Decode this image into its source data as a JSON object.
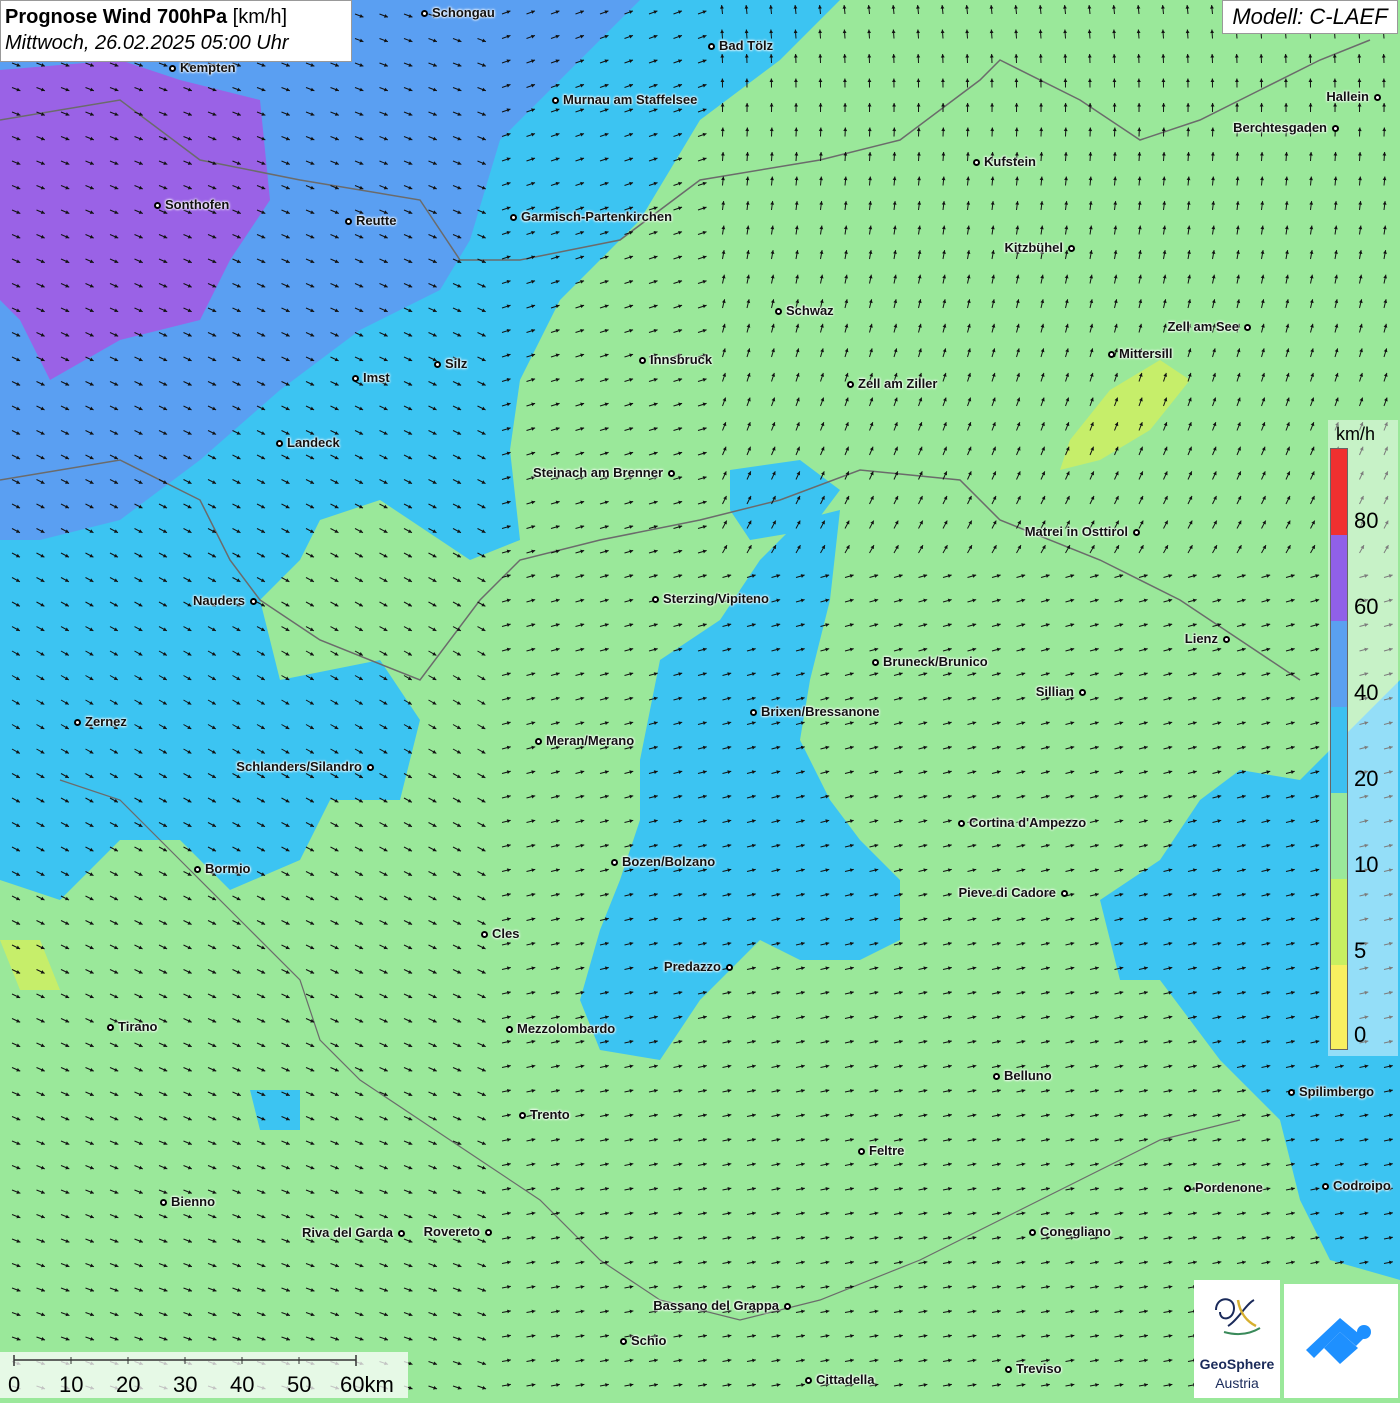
{
  "title": {
    "main": "Prognose Wind 700hPa",
    "unit": "[km/h]",
    "datetime": "Mittwoch, 26.02.2025 05:00 Uhr"
  },
  "model": "Modell: C-LAEF",
  "legend": {
    "unit": "km/h",
    "ticks": [
      "80",
      "60",
      "40",
      "20",
      "10",
      "5",
      "0"
    ],
    "colors": {
      "c80": "#f03030",
      "c60": "#9060e8",
      "c40": "#5aa0f0",
      "c20": "#3cc0f0",
      "c10": "#9ae89a",
      "c5": "#c8f060",
      "c0": "#f8f060"
    }
  },
  "scale": {
    "labels": [
      "0",
      "10",
      "20",
      "30",
      "40",
      "50",
      "60km"
    ]
  },
  "logos": {
    "geosphere_line1": "GeoSphere",
    "geosphere_line2": "Austria"
  },
  "cities": [
    {
      "name": "Schongau"
    },
    {
      "name": "Bad Tölz"
    },
    {
      "name": "Kempten"
    },
    {
      "name": "Murnau am Staffelsee"
    },
    {
      "name": "Hallein"
    },
    {
      "name": "Berchtesgaden"
    },
    {
      "name": "Kufstein"
    },
    {
      "name": "Sonthofen"
    },
    {
      "name": "Reutte"
    },
    {
      "name": "Garmisch-Partenkirchen"
    },
    {
      "name": "Kitzbühel"
    },
    {
      "name": "Schwaz"
    },
    {
      "name": "Zell am See"
    },
    {
      "name": "Innsbruck"
    },
    {
      "name": "Mittersill"
    },
    {
      "name": "Imst"
    },
    {
      "name": "Silz"
    },
    {
      "name": "Zell am Ziller"
    },
    {
      "name": "Landeck"
    },
    {
      "name": "Steinach am Brenner"
    },
    {
      "name": "Matrei in Osttirol"
    },
    {
      "name": "Nauders"
    },
    {
      "name": "Sterzing/Vipiteno"
    },
    {
      "name": "Lienz"
    },
    {
      "name": "Bruneck/Brunico"
    },
    {
      "name": "Sillian"
    },
    {
      "name": "Brixen/Bressanone"
    },
    {
      "name": "Zernez"
    },
    {
      "name": "Meran/Merano"
    },
    {
      "name": "Schlanders/Silandro"
    },
    {
      "name": "Cortina d'Ampezzo"
    },
    {
      "name": "Bozen/Bolzano"
    },
    {
      "name": "Bormio"
    },
    {
      "name": "Pieve di Cadore"
    },
    {
      "name": "Cles"
    },
    {
      "name": "Predazzo"
    },
    {
      "name": "Tirano"
    },
    {
      "name": "Mezzolombardo"
    },
    {
      "name": "Belluno"
    },
    {
      "name": "Spilimbergo"
    },
    {
      "name": "Trento"
    },
    {
      "name": "Feltre"
    },
    {
      "name": "Pordenone"
    },
    {
      "name": "Codroipo"
    },
    {
      "name": "Bienno"
    },
    {
      "name": "Riva del Garda"
    },
    {
      "name": "Rovereto"
    },
    {
      "name": "Conegliano"
    },
    {
      "name": "Bassano del Grappa"
    },
    {
      "name": "Schio"
    },
    {
      "name": "Treviso"
    },
    {
      "name": "Cittadella"
    }
  ]
}
